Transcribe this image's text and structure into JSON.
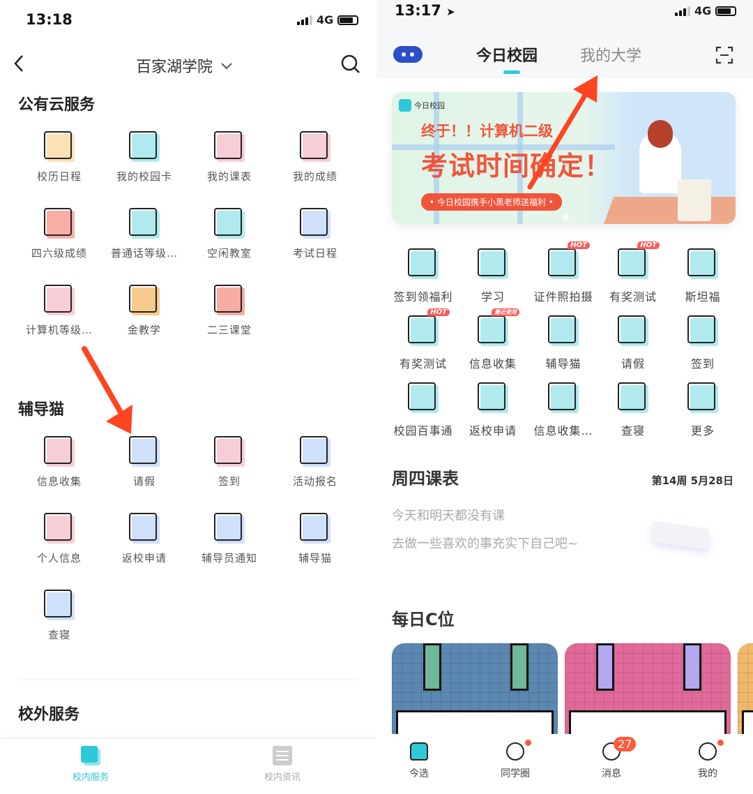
{
  "left": {
    "status": {
      "time": "13:18",
      "network": "4G"
    },
    "header": {
      "title": "百家湖学院",
      "back_icon": "chevron-left-icon",
      "dropdown_icon": "chevron-down-icon",
      "search_icon": "search-icon"
    },
    "sections": [
      {
        "title": "公有云服务",
        "items": [
          {
            "label": "校历日程",
            "icon": "calendar-clock-icon",
            "accent": "#f7c97a"
          },
          {
            "label": "我的校园卡",
            "icon": "card-icon",
            "accent": "#6fd8e0"
          },
          {
            "label": "我的课表",
            "icon": "calendar-grid-icon",
            "accent": "#f2a6b4"
          },
          {
            "label": "我的成绩",
            "icon": "score-100-icon",
            "accent": "#f2a6b4"
          },
          {
            "label": "四六级成绩",
            "icon": "cet-report-icon",
            "accent": "#f26b5b"
          },
          {
            "label": "普通话等级…",
            "icon": "mandarin-search-icon",
            "accent": "#6fd8e0"
          },
          {
            "label": "空闲教室",
            "icon": "door-icon",
            "accent": "#6fd8e0"
          },
          {
            "label": "考试日程",
            "icon": "exam-clock-icon",
            "accent": "#a8c8f5"
          },
          {
            "label": "计算机等级…",
            "icon": "score-100-icon",
            "accent": "#f2a6b4"
          },
          {
            "label": "金教学",
            "icon": "owl-house-icon",
            "accent": "#f0a030"
          },
          {
            "label": "二三课堂",
            "icon": "circle-two-icon",
            "accent": "#f06a5a"
          }
        ]
      },
      {
        "title": "辅导猫",
        "items": [
          {
            "label": "信息收集",
            "icon": "documents-icon",
            "accent": "#f2a6b4"
          },
          {
            "label": "请假",
            "icon": "calendar-leave-icon",
            "accent": "#a8c8f5"
          },
          {
            "label": "签到",
            "icon": "checkin-icon",
            "accent": "#f2a6b4"
          },
          {
            "label": "活动报名",
            "icon": "megaphone-icon",
            "accent": "#a8c8f5"
          },
          {
            "label": "个人信息",
            "icon": "profile-card-icon",
            "accent": "#f2a6b4"
          },
          {
            "label": "返校申请",
            "icon": "luggage-icon",
            "accent": "#a8c8f5"
          },
          {
            "label": "辅导员通知",
            "icon": "bell-icon",
            "accent": "#a8c8f5"
          },
          {
            "label": "辅导猫",
            "icon": "cat-icon",
            "accent": "#a8c8f5"
          },
          {
            "label": "查寝",
            "icon": "dorm-check-icon",
            "accent": "#a8c8f5"
          }
        ]
      },
      {
        "title": "校外服务",
        "items": []
      }
    ],
    "tabbar": [
      {
        "label": "校内服务",
        "icon": "layers-icon",
        "active": true
      },
      {
        "label": "校内资讯",
        "icon": "news-icon",
        "active": false
      }
    ],
    "accent": "#2ec8d8"
  },
  "right": {
    "status": {
      "time": "13:17",
      "network": "4G"
    },
    "nav": {
      "tabs": [
        "今日校园",
        "我的大学"
      ],
      "active": 0,
      "robot_icon": "robot-icon",
      "scan_icon": "scan-icon"
    },
    "banner": {
      "brand": "今日校园",
      "line1": "终于！！计算机二级",
      "line2": "考试时间确定！",
      "pill": "今日校园携手小黑老师送福利"
    },
    "grid": [
      {
        "label": "签到领福利",
        "icon": "location-pin-icon"
      },
      {
        "label": "学习",
        "icon": "book-icon"
      },
      {
        "label": "证件照拍摄",
        "icon": "camera-icon",
        "tag": "HOT"
      },
      {
        "label": "有奖测试",
        "icon": "quiz-icon",
        "tag": "HOT"
      },
      {
        "label": "斯坦福",
        "icon": "star-icon"
      },
      {
        "label": "有奖测试",
        "icon": "quiz-icon",
        "tag": "HOT"
      },
      {
        "label": "信息收集",
        "icon": "documents-icon",
        "tag": "最近使用"
      },
      {
        "label": "辅导猫",
        "icon": "cat-icon"
      },
      {
        "label": "请假",
        "icon": "calendar-leave-icon"
      },
      {
        "label": "签到",
        "icon": "checkin-icon"
      },
      {
        "label": "校园百事通",
        "icon": "glasses-face-icon"
      },
      {
        "label": "返校申请",
        "icon": "luggage-icon"
      },
      {
        "label": "信息收集…",
        "icon": "documents-icon"
      },
      {
        "label": "查寝",
        "icon": "dorm-check-icon"
      },
      {
        "label": "更多",
        "icon": "more-grid-icon"
      }
    ],
    "schedule": {
      "title": "周四课表",
      "date": "第14周 5月28日",
      "line1": "今天和明天都没有课",
      "line2": "去做一些喜欢的事充实下自己吧~"
    },
    "daily": {
      "title": "每日C位",
      "cards": [
        {
          "color": "#5b87b0",
          "arm": "#6fb89a"
        },
        {
          "color": "#df6a9a",
          "arm": "#b3a8f0"
        },
        {
          "color": "#f0b86a",
          "arm": "#f0b86a"
        }
      ]
    },
    "tabbar": [
      {
        "label": "今选",
        "icon": "home-icon"
      },
      {
        "label": "同学圈",
        "icon": "smile-icon",
        "dot": true
      },
      {
        "label": "消息",
        "icon": "chat-icon",
        "count": "27"
      },
      {
        "label": "我的",
        "icon": "user-icon",
        "dot": true
      }
    ],
    "accent": "#2ec8d8"
  },
  "annotation_color": "#ff4422"
}
